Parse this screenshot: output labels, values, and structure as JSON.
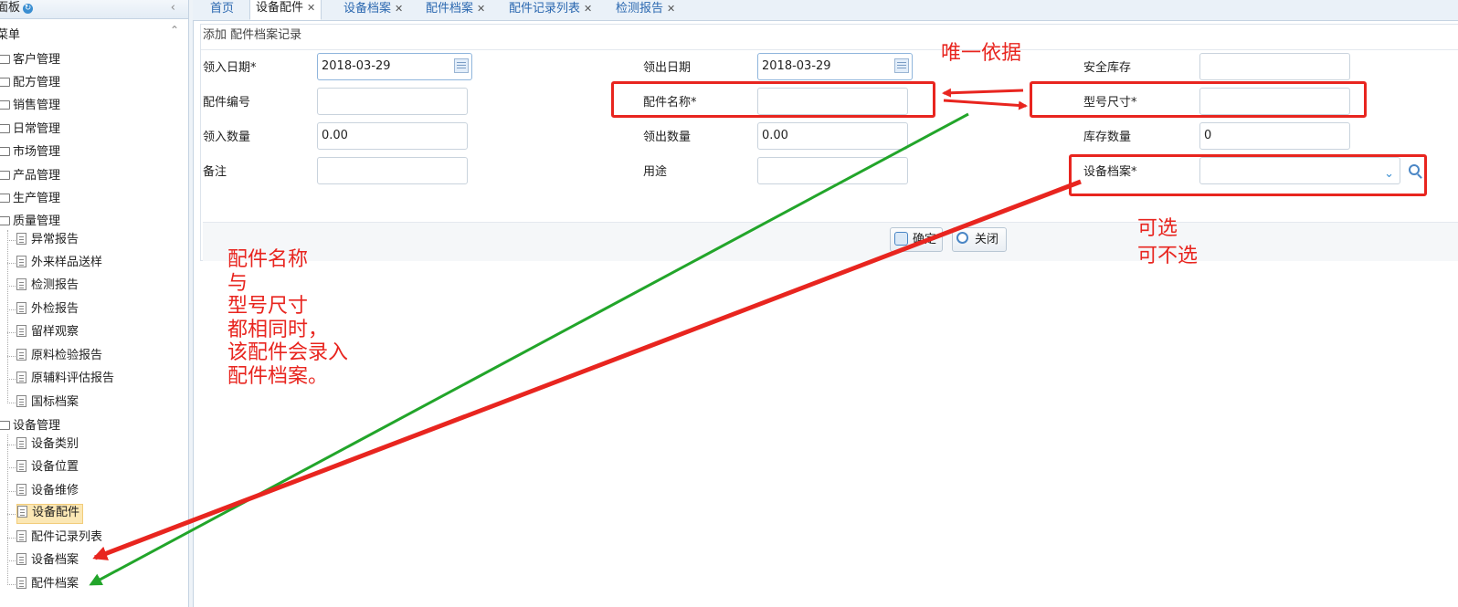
{
  "sidebar": {
    "dashboard_label": "面板",
    "menu_label": "菜单",
    "groups": [
      {
        "label": "客户管理"
      },
      {
        "label": "配方管理"
      },
      {
        "label": "销售管理"
      },
      {
        "label": "日常管理"
      },
      {
        "label": "市场管理"
      },
      {
        "label": "产品管理"
      },
      {
        "label": "生产管理"
      },
      {
        "label": "质量管理"
      },
      {
        "label": "设备管理"
      }
    ],
    "quality_items": [
      "异常报告",
      "外来样品送样",
      "检测报告",
      "外检报告",
      "留样观察",
      "原料检验报告",
      "原辅料评估报告",
      "国标档案"
    ],
    "equipment_items": [
      "设备类别",
      "设备位置",
      "设备维修",
      "设备配件",
      "配件记录列表",
      "设备档案",
      "配件档案"
    ],
    "selected_item": "设备配件"
  },
  "tabs": [
    {
      "label": "首页",
      "closable": false
    },
    {
      "label": "设备配件",
      "closable": true,
      "active": true
    },
    {
      "label": "设备档案",
      "closable": true
    },
    {
      "label": "配件档案",
      "closable": true
    },
    {
      "label": "配件记录列表",
      "closable": true
    },
    {
      "label": "检测报告",
      "closable": true
    }
  ],
  "form": {
    "title": "添加 配件档案记录",
    "fields": {
      "in_date": {
        "label": "领入日期*",
        "value": "2018-03-29"
      },
      "out_date": {
        "label": "领出日期",
        "value": "2018-03-29"
      },
      "safety_stock": {
        "label": "安全库存",
        "value": ""
      },
      "part_no": {
        "label": "配件编号",
        "value": ""
      },
      "part_name": {
        "label": "配件名称*",
        "value": ""
      },
      "model_size": {
        "label": "型号尺寸*",
        "value": ""
      },
      "in_qty": {
        "label": "领入数量",
        "value": "0.00"
      },
      "out_qty": {
        "label": "领出数量",
        "value": "0.00"
      },
      "stock_qty": {
        "label": "库存数量",
        "value": "0"
      },
      "remark": {
        "label": "备注",
        "value": ""
      },
      "usage": {
        "label": "用途",
        "value": ""
      },
      "equipment_file": {
        "label": "设备档案*",
        "value": ""
      }
    },
    "confirm_label": "确定",
    "close_label": "关闭"
  },
  "annotations": {
    "unique_basis": "唯一依据",
    "optional": "可选\n可不选",
    "note": "配件名称\n与\n型号尺寸\n都相同时，\n该配件会录入\n配件档案。",
    "red_color": "#e8251f",
    "green_color": "#22a52a"
  },
  "colors": {
    "tab_link": "#2b68b0",
    "selected_bg": "#fbe7b4",
    "input_border": "#c9d3dd"
  }
}
